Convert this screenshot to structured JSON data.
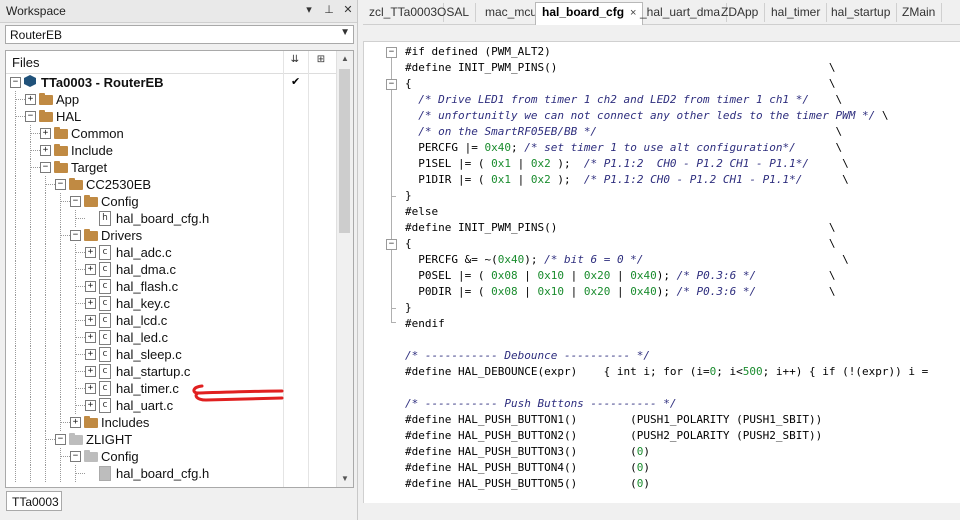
{
  "workspace": {
    "title": "Workspace",
    "controls": {
      "dropdown": "▾",
      "pin": "⊥",
      "close": "✕"
    },
    "config_value": "RouterEB",
    "files_header": "Files",
    "header_icons": [
      "build-config-icon",
      "options-icon"
    ],
    "project_check": "✔",
    "bottom_tab": "TTa0003"
  },
  "tree": [
    {
      "label": "TTa0003 - RouterEB",
      "kind": "project",
      "depth": 0,
      "exp": "−",
      "bold": true
    },
    {
      "label": "App",
      "kind": "folder",
      "depth": 1,
      "exp": "+"
    },
    {
      "label": "HAL",
      "kind": "folder",
      "depth": 1,
      "exp": "−"
    },
    {
      "label": "Common",
      "kind": "folder",
      "depth": 2,
      "exp": "+"
    },
    {
      "label": "Include",
      "kind": "folder",
      "depth": 2,
      "exp": "+"
    },
    {
      "label": "Target",
      "kind": "folder",
      "depth": 2,
      "exp": "−"
    },
    {
      "label": "CC2530EB",
      "kind": "folder",
      "depth": 3,
      "exp": "−"
    },
    {
      "label": "Config",
      "kind": "folder",
      "depth": 4,
      "exp": "−"
    },
    {
      "label": "hal_board_cfg.h",
      "kind": "file",
      "glyph": "h",
      "depth": 5,
      "exp": ""
    },
    {
      "label": "Drivers",
      "kind": "folder",
      "depth": 4,
      "exp": "−"
    },
    {
      "label": "hal_adc.c",
      "kind": "file",
      "glyph": "c",
      "depth": 5,
      "exp": "+"
    },
    {
      "label": "hal_dma.c",
      "kind": "file",
      "glyph": "c",
      "depth": 5,
      "exp": "+"
    },
    {
      "label": "hal_flash.c",
      "kind": "file",
      "glyph": "c",
      "depth": 5,
      "exp": "+"
    },
    {
      "label": "hal_key.c",
      "kind": "file",
      "glyph": "c",
      "depth": 5,
      "exp": "+"
    },
    {
      "label": "hal_lcd.c",
      "kind": "file",
      "glyph": "c",
      "depth": 5,
      "exp": "+"
    },
    {
      "label": "hal_led.c",
      "kind": "file",
      "glyph": "c",
      "depth": 5,
      "exp": "+"
    },
    {
      "label": "hal_sleep.c",
      "kind": "file",
      "glyph": "c",
      "depth": 5,
      "exp": "+"
    },
    {
      "label": "hal_startup.c",
      "kind": "file",
      "glyph": "c",
      "depth": 5,
      "exp": "+"
    },
    {
      "label": "hal_timer.c",
      "kind": "file",
      "glyph": "c",
      "depth": 5,
      "exp": "+"
    },
    {
      "label": "hal_uart.c",
      "kind": "file",
      "glyph": "c",
      "depth": 5,
      "exp": "+"
    },
    {
      "label": "Includes",
      "kind": "folder",
      "depth": 4,
      "exp": "+"
    },
    {
      "label": "ZLIGHT",
      "kind": "folder-grey",
      "depth": 3,
      "exp": "−"
    },
    {
      "label": "Config",
      "kind": "folder-grey",
      "depth": 4,
      "exp": "−"
    },
    {
      "label": "hal_board_cfg.h",
      "kind": "file-grey",
      "glyph": "",
      "depth": 5,
      "exp": ""
    }
  ],
  "editor": {
    "tabs": [
      {
        "label": "zcl_TTa0003",
        "active": false
      },
      {
        "label": "OSAL",
        "active": false
      },
      {
        "label": "mac_mcu",
        "active": false
      },
      {
        "label": "hal_board_cfg",
        "active": true,
        "close": "×"
      },
      {
        "label": "_hal_uart_dma",
        "active": false
      },
      {
        "label": "ZDApp",
        "active": false
      },
      {
        "label": "hal_timer",
        "active": false
      },
      {
        "label": "hal_startup",
        "active": false
      },
      {
        "label": "ZMain",
        "active": false
      }
    ],
    "lines": [
      [
        [
          "t",
          "#if defined (PWM_ALT2)"
        ]
      ],
      [
        [
          "t",
          "#define INIT_PWM_PINS()                                         \\"
        ]
      ],
      [
        [
          "t",
          "{                                                               \\"
        ]
      ],
      [
        [
          "t",
          "  "
        ],
        [
          "c",
          "/* Drive LED1 from timer 1 ch2 and LED2 from timer 1 ch1 */"
        ],
        [
          "t",
          "    \\"
        ]
      ],
      [
        [
          "t",
          "  "
        ],
        [
          "c",
          "/* unfortunitly we can not connect any other leds to the timer PWM */"
        ],
        [
          "t",
          " \\"
        ]
      ],
      [
        [
          "t",
          "  "
        ],
        [
          "c",
          "/* on the SmartRF05EB/BB */"
        ],
        [
          "t",
          "                                    \\"
        ]
      ],
      [
        [
          "t",
          "  PERCFG |= "
        ],
        [
          "n",
          "0x40"
        ],
        [
          "t",
          "; "
        ],
        [
          "c",
          "/* set timer 1 to use alt configuration*/"
        ],
        [
          "t",
          "      \\"
        ]
      ],
      [
        [
          "t",
          "  P1SEL |= ( "
        ],
        [
          "n",
          "0x1"
        ],
        [
          "t",
          " | "
        ],
        [
          "n",
          "0x2"
        ],
        [
          "t",
          " );  "
        ],
        [
          "c",
          "/* P1.1:2  CH0 - P1.2 CH1 - P1.1*/"
        ],
        [
          "t",
          "     \\"
        ]
      ],
      [
        [
          "t",
          "  P1DIR |= ( "
        ],
        [
          "n",
          "0x1"
        ],
        [
          "t",
          " | "
        ],
        [
          "n",
          "0x2"
        ],
        [
          "t",
          " );  "
        ],
        [
          "c",
          "/* P1.1:2 CH0 - P1.2 CH1 - P1.1*/"
        ],
        [
          "t",
          "      \\"
        ]
      ],
      [
        [
          "t",
          "}"
        ]
      ],
      [
        [
          "t",
          "#else"
        ]
      ],
      [
        [
          "t",
          "#define INIT_PWM_PINS()                                         \\"
        ]
      ],
      [
        [
          "t",
          "{                                                               \\"
        ]
      ],
      [
        [
          "t",
          "  PERCFG &= ~("
        ],
        [
          "n",
          "0x40"
        ],
        [
          "t",
          "); "
        ],
        [
          "c",
          "/* bit 6 = 0 */"
        ],
        [
          "t",
          "                              \\"
        ]
      ],
      [
        [
          "t",
          "  P0SEL |= ( "
        ],
        [
          "n",
          "0x08"
        ],
        [
          "t",
          " | "
        ],
        [
          "n",
          "0x10"
        ],
        [
          "t",
          " | "
        ],
        [
          "n",
          "0x20"
        ],
        [
          "t",
          " | "
        ],
        [
          "n",
          "0x40"
        ],
        [
          "t",
          "); "
        ],
        [
          "c",
          "/* P0.3:6 */"
        ],
        [
          "t",
          "           \\"
        ]
      ],
      [
        [
          "t",
          "  P0DIR |= ( "
        ],
        [
          "n",
          "0x08"
        ],
        [
          "t",
          " | "
        ],
        [
          "n",
          "0x10"
        ],
        [
          "t",
          " | "
        ],
        [
          "n",
          "0x20"
        ],
        [
          "t",
          " | "
        ],
        [
          "n",
          "0x40"
        ],
        [
          "t",
          "); "
        ],
        [
          "c",
          "/* P0.3:6 */"
        ],
        [
          "t",
          "           \\"
        ]
      ],
      [
        [
          "t",
          "}"
        ]
      ],
      [
        [
          "t",
          "#endif"
        ]
      ],
      [
        [
          "t",
          ""
        ]
      ],
      [
        [
          "c",
          "/* ----------- Debounce ---------- */"
        ]
      ],
      [
        [
          "t",
          "#define HAL_DEBOUNCE(expr)    { int i; for (i="
        ],
        [
          "n",
          "0"
        ],
        [
          "t",
          "; i<"
        ],
        [
          "n",
          "500"
        ],
        [
          "t",
          "; i++) { if (!(expr)) i = "
        ]
      ],
      [
        [
          "t",
          ""
        ]
      ],
      [
        [
          "c",
          "/* ----------- Push Buttons ---------- */"
        ]
      ],
      [
        [
          "t",
          "#define HAL_PUSH_BUTTON1()        (PUSH1_POLARITY (PUSH1_SBIT))"
        ]
      ],
      [
        [
          "t",
          "#define HAL_PUSH_BUTTON2()        (PUSH2_POLARITY (PUSH2_SBIT))"
        ]
      ],
      [
        [
          "t",
          "#define HAL_PUSH_BUTTON3()        ("
        ],
        [
          "n",
          "0"
        ],
        [
          "t",
          ")"
        ]
      ],
      [
        [
          "t",
          "#define HAL_PUSH_BUTTON4()        ("
        ],
        [
          "n",
          "0"
        ],
        [
          "t",
          ")"
        ]
      ],
      [
        [
          "t",
          "#define HAL_PUSH_BUTTON5()        ("
        ],
        [
          "n",
          "0"
        ],
        [
          "t",
          ")"
        ]
      ]
    ]
  },
  "colors": {
    "comment": "#2e2e7e",
    "number": "#1a8c2e",
    "folder": "#c08a43",
    "annotation": "#e02020"
  }
}
